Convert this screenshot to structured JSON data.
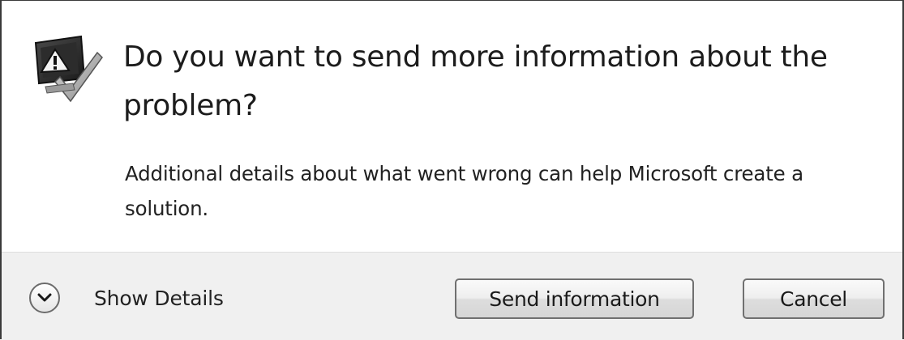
{
  "dialog": {
    "heading": "Do you want to send more information about the problem?",
    "detail": "Additional details about what went wrong can help Microsoft create a solution.",
    "icon": "warning-monitor-icon"
  },
  "footer": {
    "show_details_label": "Show Details",
    "show_details_icon": "chevron-down-icon",
    "send_button_label": "Send information",
    "cancel_button_label": "Cancel"
  }
}
